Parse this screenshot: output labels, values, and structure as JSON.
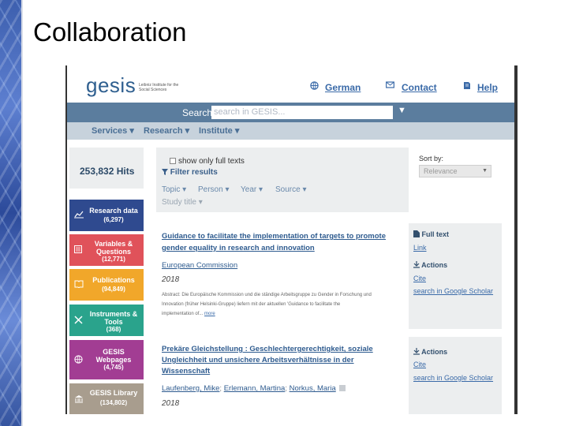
{
  "slide": {
    "title": "Collaboration"
  },
  "header": {
    "logo": "gesis",
    "logo_sub": "Leibniz Institute for the Social Sciences",
    "links": [
      {
        "label": "German",
        "icon": "globe-icon"
      },
      {
        "label": "Contact",
        "icon": "mail-icon"
      },
      {
        "label": "Help",
        "icon": "book-icon"
      }
    ]
  },
  "search": {
    "label": "Search",
    "placeholder": "search in GESIS...",
    "dropdown": "▼"
  },
  "nav": {
    "items": [
      "Services ▾",
      "Research ▾",
      "Institute ▾"
    ]
  },
  "hits": "253,832 Hits",
  "filters": {
    "full_texts": "show only full texts",
    "filter_results": "Filter results",
    "tags": [
      "Topic ▾",
      "Person ▾",
      "Year ▾",
      "Source ▾",
      "Study title ▾"
    ]
  },
  "sort": {
    "label": "Sort by:",
    "value": "Relevance"
  },
  "categories": [
    {
      "label": "Research data",
      "count": "(6,297)",
      "color": "#2f4a8f",
      "icon": "chart-icon"
    },
    {
      "label": "Variables & Questions",
      "count": "(12,771)",
      "color": "#e0525a",
      "icon": "list-icon"
    },
    {
      "label": "Publications",
      "count": "(94,849)",
      "color": "#f1a72a",
      "icon": "book-icon"
    },
    {
      "label": "Instruments & Tools",
      "count": "(368)",
      "color": "#2aa38c",
      "icon": "tools-icon"
    },
    {
      "label": "GESIS Webpages",
      "count": "(4,745)",
      "color": "#a23d93",
      "icon": "globe-icon"
    },
    {
      "label": "GESIS Library",
      "count": "(134,802)",
      "color": "#a89d8e",
      "icon": "library-icon"
    }
  ],
  "results": [
    {
      "title_lines": [
        "Guidance to facilitate the implementation of targets to promote",
        "gender equality in research and innovation"
      ],
      "author": "European Commission",
      "year": "2018",
      "abstract_lines": [
        "Abstract: Die Europäische Kommission und die ständige Arbeitsgruppe zu Gender in Forschung und",
        "Innovation (früher Helsinki-Gruppe) liefern mit der aktuellen 'Guidance to facilitate the",
        "implementation of..."
      ],
      "more": "more",
      "panel": {
        "full_text": "Full text",
        "link": "Link",
        "actions": "Actions",
        "cite": "Cite",
        "scholar": "search in Google Scholar"
      }
    },
    {
      "title_lines": [
        "Prekäre Gleichstellung : Geschlechtergerechtigkeit, soziale",
        "Ungleichheit und unsichere Arbeitsverhältnisse in der",
        "Wissenschaft"
      ],
      "authors": [
        "Laufenberg, Mike",
        "Erlemann, Martina",
        "Norkus, Maria"
      ],
      "year": "2018",
      "panel": {
        "actions": "Actions",
        "cite": "Cite",
        "scholar": "search in Google Scholar"
      }
    }
  ]
}
